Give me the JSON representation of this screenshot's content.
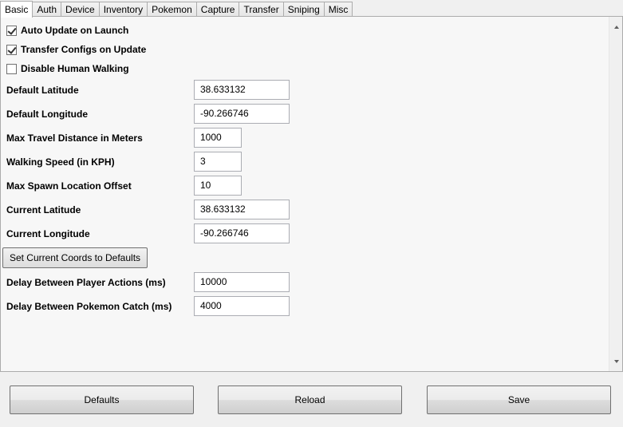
{
  "tabs": [
    {
      "label": "Basic",
      "active": true
    },
    {
      "label": "Auth"
    },
    {
      "label": "Device"
    },
    {
      "label": "Inventory"
    },
    {
      "label": "Pokemon"
    },
    {
      "label": "Capture"
    },
    {
      "label": "Transfer"
    },
    {
      "label": "Sniping"
    },
    {
      "label": "Misc"
    }
  ],
  "checkboxes": {
    "auto_update": {
      "label": "Auto Update on Launch",
      "checked": true
    },
    "transfer_configs": {
      "label": "Transfer Configs on Update",
      "checked": true
    },
    "disable_walking": {
      "label": "Disable Human Walking",
      "checked": false
    }
  },
  "fields": {
    "default_latitude": {
      "label": "Default Latitude",
      "value": "38.633132"
    },
    "default_longitude": {
      "label": "Default Longitude",
      "value": "-90.266746"
    },
    "max_travel": {
      "label": "Max Travel Distance in Meters",
      "value": "1000"
    },
    "walking_speed": {
      "label": "Walking Speed (in KPH)",
      "value": "3"
    },
    "max_spawn_offset": {
      "label": "Max Spawn Location Offset",
      "value": "10"
    },
    "current_latitude": {
      "label": "Current Latitude",
      "value": "38.633132"
    },
    "current_longitude": {
      "label": "Current Longitude",
      "value": "-90.266746"
    },
    "delay_actions": {
      "label": "Delay Between Player Actions (ms)",
      "value": "10000"
    },
    "delay_catch": {
      "label": "Delay Between Pokemon Catch (ms)",
      "value": "4000"
    }
  },
  "set_coords_button": "Set Current Coords to Defaults",
  "buttons": {
    "defaults": "Defaults",
    "reload": "Reload",
    "save": "Save"
  }
}
